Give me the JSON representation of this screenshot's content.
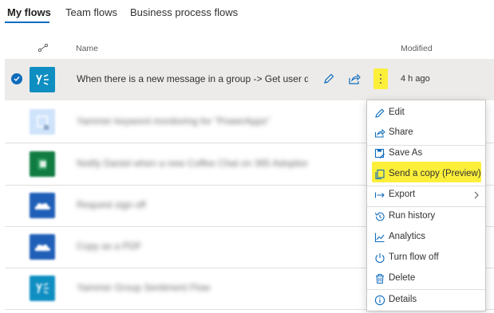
{
  "tabs": [
    {
      "label": "My flows",
      "active": true
    },
    {
      "label": "Team flows",
      "active": false
    },
    {
      "label": "Business process flows",
      "active": false
    }
  ],
  "table": {
    "col_name": "Name",
    "col_modified": "Modified",
    "rows": [
      {
        "name": "When there is a new message in a group -> Get user d...",
        "modified": "4 h ago",
        "icon": "yammer-icon",
        "selected": true
      },
      {
        "name": "Yammer keyword monitoring for \"PowerApps\"",
        "modified": "",
        "icon": "calendar-icon",
        "selected": false
      },
      {
        "name": "Notify Daniel when a new Coffee Chat on 365 Adoption...",
        "modified": "",
        "icon": "planner-icon",
        "selected": false
      },
      {
        "name": "Request sign off",
        "modified": "",
        "icon": "onedrive-icon",
        "selected": false
      },
      {
        "name": "Copy as a PDF",
        "modified": "",
        "icon": "onedrive-icon",
        "selected": false
      },
      {
        "name": "Yammer Group Sentiment Flow",
        "modified": "",
        "icon": "yammer-icon",
        "selected": false
      }
    ]
  },
  "menu": {
    "items": [
      {
        "label": "Edit",
        "icon": "pencil-icon"
      },
      {
        "label": "Share",
        "icon": "share-icon"
      },
      {
        "label": "Save As",
        "icon": "save-as-icon"
      },
      {
        "label": "Send a copy (Preview)",
        "icon": "copy-icon",
        "highlighted": true
      },
      {
        "label": "Export",
        "icon": "export-icon",
        "submenu": true
      },
      {
        "label": "Run history",
        "icon": "history-icon"
      },
      {
        "label": "Analytics",
        "icon": "analytics-icon"
      },
      {
        "label": "Turn flow off",
        "icon": "power-icon"
      },
      {
        "label": "Delete",
        "icon": "trash-icon"
      },
      {
        "label": "Details",
        "icon": "info-icon"
      }
    ]
  },
  "colors": {
    "accent": "#0f6cbd",
    "highlight": "#fbef3a",
    "yammer": "#0f8ec2",
    "planner": "#107c41",
    "onedrive": "#1f5fb8"
  }
}
